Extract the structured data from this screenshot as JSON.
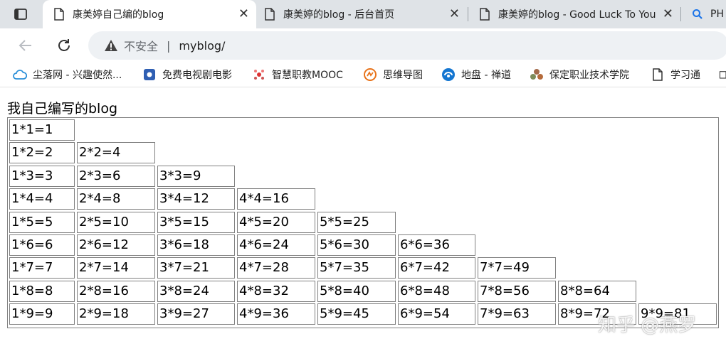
{
  "tabs": [
    {
      "title": "康美婷自己编的blog",
      "active": true
    },
    {
      "title": "康美婷的blog - 后台首页",
      "active": false
    },
    {
      "title": "康美婷的blog - Good Luck To You",
      "active": false
    },
    {
      "title": "PH",
      "active": false
    }
  ],
  "toolbar": {
    "security_label": "不安全",
    "separator": "|",
    "url": "myblog/"
  },
  "bookmarks": [
    {
      "label": "尘落网 - 兴趣使然...",
      "icon": "cloud-icon"
    },
    {
      "label": "免费电视剧电影",
      "icon": "tv-icon"
    },
    {
      "label": "智慧职教MOOC",
      "icon": "mooc-icon"
    },
    {
      "label": "思维导图",
      "icon": "mindmap-icon"
    },
    {
      "label": "地盘 - 禅道",
      "icon": "zentao-icon"
    },
    {
      "label": "保定职业技术学院",
      "icon": "school-icon"
    },
    {
      "label": "学习通",
      "icon": "document-icon"
    }
  ],
  "page": {
    "heading": "我自己编写的blog",
    "rows": [
      [
        "1*1=1"
      ],
      [
        "1*2=2",
        "2*2=4"
      ],
      [
        "1*3=3",
        "2*3=6",
        "3*3=9"
      ],
      [
        "1*4=4",
        "2*4=8",
        "3*4=12",
        "4*4=16"
      ],
      [
        "1*5=5",
        "2*5=10",
        "3*5=15",
        "4*5=20",
        "5*5=25"
      ],
      [
        "1*6=6",
        "2*6=12",
        "3*6=18",
        "4*6=24",
        "5*6=30",
        "6*6=36"
      ],
      [
        "1*7=7",
        "2*7=14",
        "3*7=21",
        "4*7=28",
        "5*7=35",
        "6*7=42",
        "7*7=49"
      ],
      [
        "1*8=8",
        "2*8=16",
        "3*8=24",
        "4*8=32",
        "5*8=40",
        "6*8=48",
        "7*8=56",
        "8*8=64"
      ],
      [
        "1*9=9",
        "2*9=18",
        "3*9=27",
        "4*9=36",
        "5*9=45",
        "6*9=54",
        "7*9=63",
        "8*9=72",
        "9*9=81"
      ]
    ]
  },
  "watermark": "知乎 @燕罗"
}
